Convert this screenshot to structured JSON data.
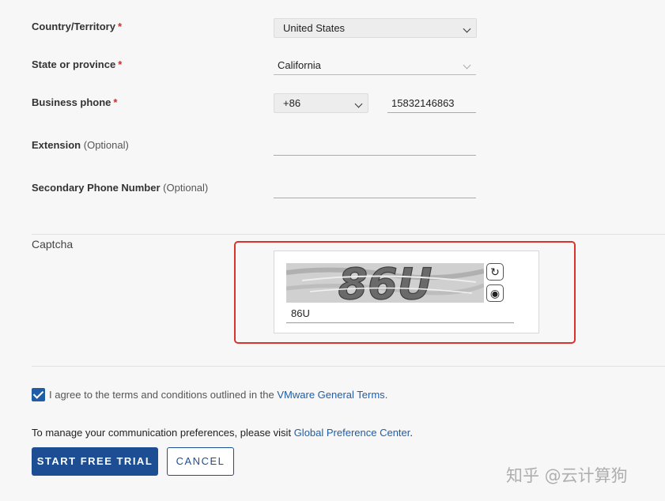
{
  "form": {
    "country": {
      "label": "Country/Territory",
      "required": "*",
      "value": "United States"
    },
    "state": {
      "label": "State or province",
      "required": "*",
      "value": "California"
    },
    "business_phone": {
      "label": "Business phone",
      "required": "*",
      "code": "+86",
      "number": "15832146863"
    },
    "extension": {
      "label": "Extension",
      "optional": "(Optional)",
      "value": ""
    },
    "secondary_phone": {
      "label": "Secondary Phone Number",
      "optional": "(Optional)",
      "value": ""
    }
  },
  "captcha": {
    "label": "Captcha",
    "image_text": "86U",
    "input_value": "86U",
    "refresh_icon": "refresh-icon",
    "audio_icon": "audio-icon"
  },
  "agreement": {
    "checked": true,
    "text": "I agree to the terms and conditions outlined in the",
    "link": "VMware General Terms",
    "suffix": "."
  },
  "preferences": {
    "text": "To manage your communication preferences, please visit",
    "link": "Global Preference Center",
    "suffix": "."
  },
  "buttons": {
    "start": "START FREE TRIAL",
    "cancel": "CANCEL"
  },
  "watermark": "知乎 @云计算狗",
  "colors": {
    "accent": "#1d4d92",
    "required": "#d12c2c",
    "highlight": "#d8342c"
  }
}
